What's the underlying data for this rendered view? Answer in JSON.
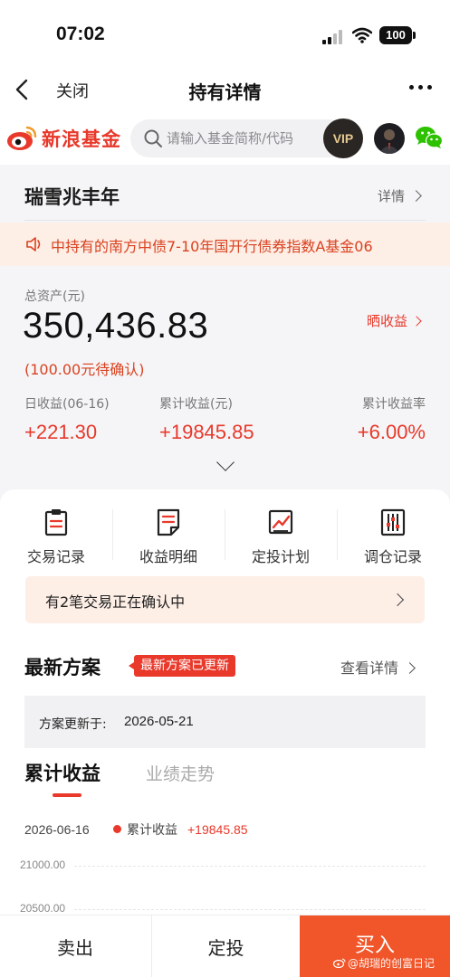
{
  "status_bar": {
    "time": "07:02",
    "battery": "100"
  },
  "nav": {
    "close_label": "关闭",
    "title": "持有详情"
  },
  "brand": {
    "logo_text": "新浪基金",
    "search_placeholder": "请输入基金简称/代码",
    "vip_label": "VIP"
  },
  "fund": {
    "name": "瑞雪兆丰年",
    "detail_link": "详情"
  },
  "notice": {
    "text": "中持有的南方中债7-10年国开行债券指数A基金06"
  },
  "assets": {
    "label": "总资产(元)",
    "value": "350,436.83",
    "pending": "(100.00元待确认)",
    "share_link": "晒收益",
    "metrics": [
      {
        "label": "日收益(06-16)",
        "value": "+221.30"
      },
      {
        "label": "累计收益(元)",
        "value": "+19845.85"
      },
      {
        "label": "累计收益率",
        "value": "+6.00%"
      }
    ]
  },
  "quick_actions": [
    {
      "label": "交易记录",
      "icon": "clipboard-icon"
    },
    {
      "label": "收益明细",
      "icon": "document-icon"
    },
    {
      "label": "定投计划",
      "icon": "trend-chart-icon"
    },
    {
      "label": "调仓记录",
      "icon": "sliders-icon"
    }
  ],
  "confirm_bar": {
    "text": "有2笔交易正在确认中"
  },
  "plan": {
    "title": "最新方案",
    "badge": "最新方案已更新",
    "more_link": "查看详情",
    "date_label": "方案更新于:",
    "date_value": "2026-05-21"
  },
  "tabs": {
    "active": "累计收益",
    "inactive": "业绩走势"
  },
  "chart": {
    "date": "2026-06-16",
    "legend_label": "累计收益",
    "legend_value": "+19845.85",
    "y_ticks": [
      "21000.00",
      "20500.00"
    ]
  },
  "colors": {
    "accent": "#e8392b",
    "buy_button": "#f0562a",
    "notice_bg": "#fdeee6"
  },
  "bottom_bar": {
    "sell": "卖出",
    "auto_invest": "定投",
    "buy": "买入"
  },
  "watermark": {
    "text": "@胡瑞的创富日记"
  }
}
